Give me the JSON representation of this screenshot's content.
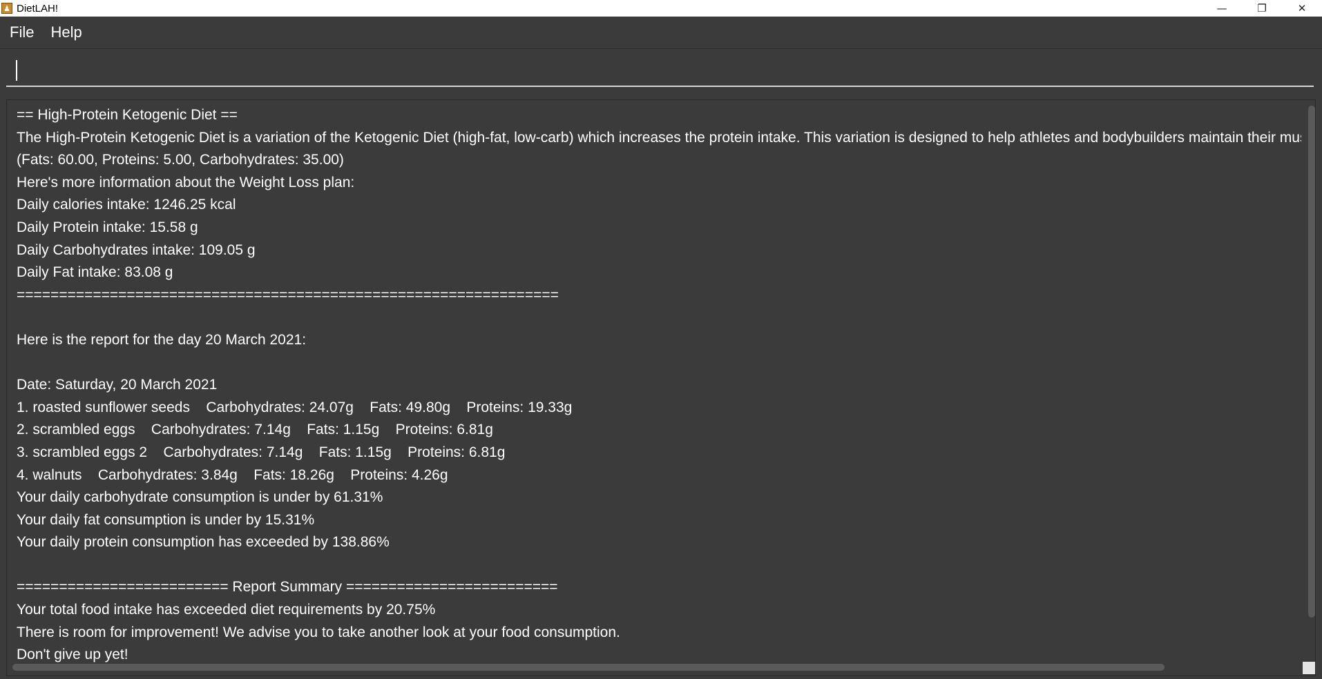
{
  "window": {
    "title": "DietLAH!",
    "app_icon_glyph": "♟",
    "controls": {
      "minimize": "—",
      "maximize": "❐",
      "close": "✕"
    }
  },
  "menu": {
    "file": "File",
    "help": "Help"
  },
  "command": {
    "value": "",
    "placeholder": ""
  },
  "result": {
    "lines": [
      "== High-Protein Ketogenic Diet ==",
      "The High-Protein Ketogenic Diet is a variation of the Ketogenic Diet (high-fat, low-carb) which increases the protein intake. This variation is designed to help athletes and bodybuilders maintain their muscle m",
      "(Fats: 60.00, Proteins: 5.00, Carbohydrates: 35.00)",
      "Here's more information about the Weight Loss plan:",
      "Daily calories intake: 1246.25 kcal",
      "Daily Protein intake: 15.58 g",
      "Daily Carbohydrates intake: 109.05 g",
      "Daily Fat intake: 83.08 g",
      "================================================================",
      "",
      "Here is the report for the day 20 March 2021:",
      "",
      "Date: Saturday, 20 March 2021",
      "1. roasted sunflower seeds    Carbohydrates: 24.07g    Fats: 49.80g    Proteins: 19.33g",
      "2. scrambled eggs    Carbohydrates: 7.14g    Fats: 1.15g    Proteins: 6.81g",
      "3. scrambled eggs 2    Carbohydrates: 7.14g    Fats: 1.15g    Proteins: 6.81g",
      "4. walnuts    Carbohydrates: 3.84g    Fats: 18.26g    Proteins: 4.26g",
      "Your daily carbohydrate consumption is under by 61.31%",
      "Your daily fat consumption is under by 15.31%",
      "Your daily protein consumption has exceeded by 138.86%",
      "",
      "========================= Report Summary =========================",
      "Your total food intake has exceeded diet requirements by 20.75%",
      "There is room for improvement! We advise you to take another look at your food consumption.",
      "Don't give up yet!"
    ]
  }
}
